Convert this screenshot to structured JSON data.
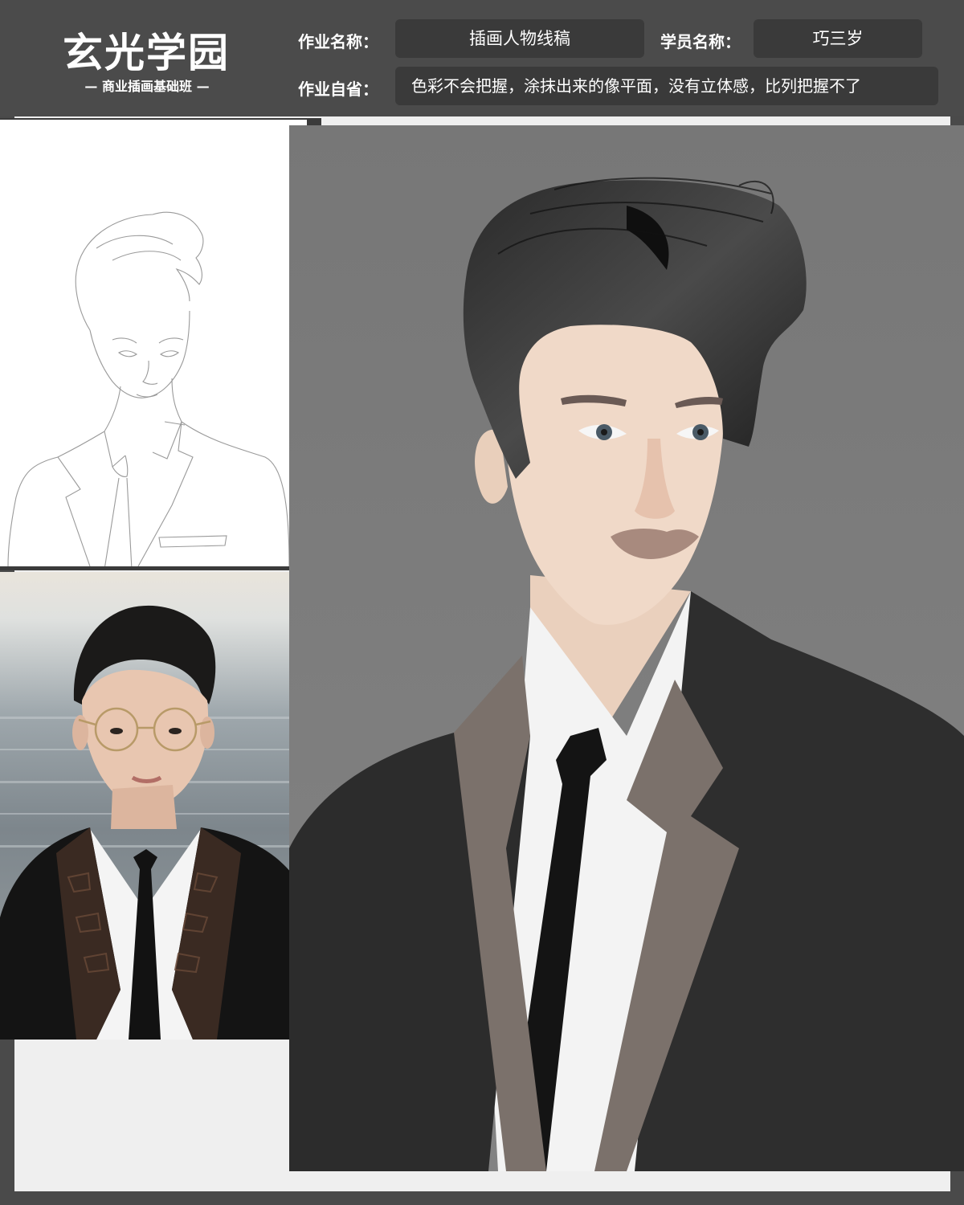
{
  "header": {
    "logo_title": "玄光学园",
    "logo_subtitle": "— 商业插画基础班 —",
    "assignment_name_label": "作业名称：",
    "assignment_name_value": "插画人物线稿",
    "student_name_label": "学员名称：",
    "student_name_value": "巧三岁",
    "self_review_label": "作业自省：",
    "self_review_value": "色彩不会把握，涂抹出来的像平面，没有立体感，比列把握不了"
  },
  "colors": {
    "header_bg": "#4b4b4b",
    "field_bg": "#3a3a3a",
    "panel_bg": "#efefef",
    "painting_bg": "#7b7b7b",
    "suit": "#2e2e2e",
    "lapel": "#7b716b",
    "skin": "#f2d8c6",
    "hair": "#1e1e1e"
  },
  "images": {
    "sketch": "line-art-sketch",
    "reference_photo": "reference-photo",
    "painting": "digital-painting"
  }
}
